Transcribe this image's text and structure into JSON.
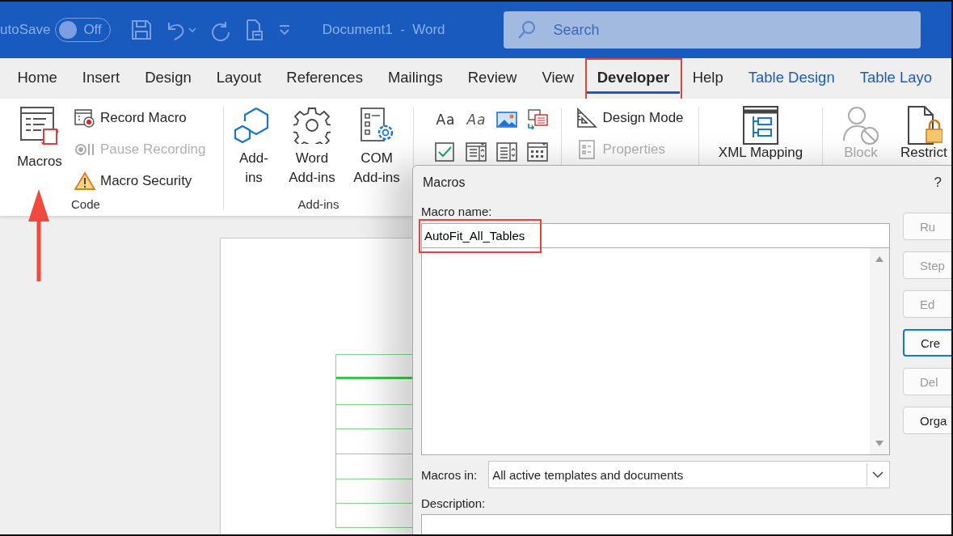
{
  "title_bar": {
    "autosave_label": "utoSave",
    "autosave": {
      "on": false,
      "label": "Off"
    },
    "document_title": "Document1  -  Word",
    "search": {
      "placeholder": "Search"
    }
  },
  "tabs": [
    {
      "label": "Home",
      "selected": false,
      "kind": "standard",
      "highlighted": false
    },
    {
      "label": "Insert",
      "selected": false,
      "kind": "standard",
      "highlighted": false
    },
    {
      "label": "Design",
      "selected": false,
      "kind": "standard",
      "highlighted": false
    },
    {
      "label": "Layout",
      "selected": false,
      "kind": "standard",
      "highlighted": false
    },
    {
      "label": "References",
      "selected": false,
      "kind": "standard",
      "highlighted": false
    },
    {
      "label": "Mailings",
      "selected": false,
      "kind": "standard",
      "highlighted": false
    },
    {
      "label": "Review",
      "selected": false,
      "kind": "standard",
      "highlighted": false
    },
    {
      "label": "View",
      "selected": false,
      "kind": "standard",
      "highlighted": false
    },
    {
      "label": "Developer",
      "selected": true,
      "kind": "standard",
      "highlighted": true
    },
    {
      "label": "Help",
      "selected": false,
      "kind": "standard",
      "highlighted": false
    },
    {
      "label": "Table Design",
      "selected": false,
      "kind": "contextual",
      "highlighted": false
    },
    {
      "label": "Table Layo",
      "selected": false,
      "kind": "contextual",
      "highlighted": false
    }
  ],
  "code_group": {
    "label": "Code",
    "large_button": {
      "label": "Macros",
      "pointed": true
    },
    "buttons": [
      {
        "label": "Record Macro",
        "disabled": false,
        "kind": "record"
      },
      {
        "label": "Pause Recording",
        "disabled": true,
        "kind": "pause"
      },
      {
        "label": "Macro Security",
        "disabled": false,
        "kind": "security"
      }
    ]
  },
  "addins_group": {
    "label": "Add-ins",
    "buttons": [
      {
        "label": "Add-ins",
        "kind": "addins"
      },
      {
        "label": "Word Add-ins",
        "kind": "word"
      },
      {
        "label": "COM Add-ins",
        "kind": "com"
      }
    ]
  },
  "controls_group": {
    "icons": [
      {
        "kind": "rich-text",
        "glyph": "Aa"
      },
      {
        "kind": "plain-text",
        "glyph": "Aa"
      },
      {
        "kind": "picture"
      },
      {
        "kind": "building-blocks"
      },
      {
        "kind": "checkbox"
      },
      {
        "kind": "combo"
      },
      {
        "kind": "dropdown"
      },
      {
        "kind": "date"
      }
    ],
    "buttons": [
      {
        "label": "Design Mode",
        "disabled": false,
        "kind": "design"
      },
      {
        "label": "Properties",
        "disabled": true,
        "kind": "properties"
      }
    ]
  },
  "xml_group": {
    "label": "XML Mapping"
  },
  "protect_group": {
    "buttons": [
      {
        "label": "Block",
        "disabled": true,
        "kind": "block"
      },
      {
        "label": "Restrict",
        "disabled": false,
        "kind": "restrict"
      }
    ]
  },
  "dialog": {
    "title": "Macros",
    "help": "?",
    "name_label": "Macro name:",
    "name_value": "AutoFit_All_Tables",
    "name_highlighted": true,
    "buttons": [
      {
        "label": "Ru",
        "disabled": true,
        "focused": false
      },
      {
        "label": "Step",
        "disabled": true,
        "focused": false
      },
      {
        "label": "Ed",
        "disabled": true,
        "focused": false
      },
      {
        "label": "Cre",
        "disabled": false,
        "focused": true
      },
      {
        "label": "Del",
        "disabled": true,
        "focused": false
      },
      {
        "label": "Orga",
        "disabled": false,
        "focused": false
      }
    ],
    "macros_in": {
      "label": "Macros in:",
      "value": "All active templates and documents"
    },
    "description_label": "Description:"
  }
}
